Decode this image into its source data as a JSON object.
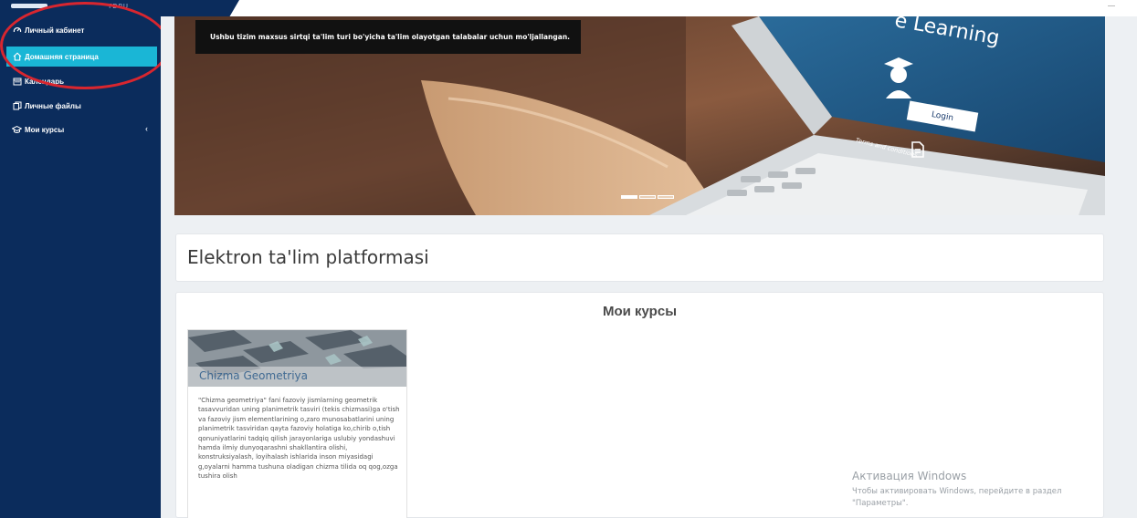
{
  "header": {
    "brand_sub": "TDPU"
  },
  "sidebar": {
    "items": [
      {
        "label": "Личный кабинет",
        "icon": "dashboard-icon",
        "active": false
      },
      {
        "label": "Домашняя страница",
        "icon": "home-icon",
        "active": true
      },
      {
        "label": "Календарь",
        "icon": "calendar-icon",
        "active": false
      },
      {
        "label": "Личные файлы",
        "icon": "files-icon",
        "active": false
      },
      {
        "label": "Мои курсы",
        "icon": "graduation-cap-icon",
        "active": false,
        "expandable": true
      }
    ],
    "colors": {
      "background": "#0b2c5c",
      "active": "#1ab6d6",
      "annotation": "#d8262f"
    }
  },
  "banner": {
    "caption": "Ushbu tizim maxsus sirtqi ta'lim turi bo'yicha ta'lim olayotgan talabalar uchun mo'ljallangan.",
    "laptop_title": "e Learning",
    "login_label": "Login",
    "terms_label": "Terms and conditions",
    "slides": 3,
    "active_slide": 1
  },
  "main": {
    "page_title": "Elektron ta'lim platformasi",
    "courses_heading": "Мои курсы",
    "courses": [
      {
        "name": "Chizma Geometriya",
        "description": "\"Chizma geometriya\" fani fazoviy jismlarning geometrik tasavvuridan uning planimetrik tasviri (tekis chizmasi)ga o'tish va fazoviy jism elementlarining o,zaro munosabatlarini uning planimetrik tasviridan qayta fazoviy holatiga ko,chirib o,tish qonuniyatlarini tadqiq qilish jarayonlariga uslubiy yondashuvi hamda ilmiy dunyoqarashni shakllantira olishi, konstruksiyalash, loyihalash ishlarida inson miyasidagi g,oyalarni hamma tushuna oladigan chizma tilida oq qog,ozga tushira olish"
      }
    ]
  },
  "windows_watermark": {
    "title": "Активация Windows",
    "text": "Чтобы активировать Windows, перейдите в раздел \"Параметры\"."
  }
}
